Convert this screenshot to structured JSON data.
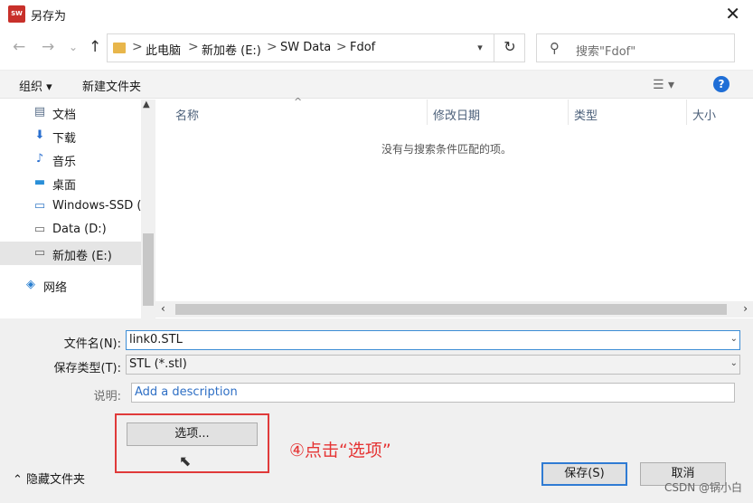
{
  "window": {
    "title": "另存为",
    "app_icon_text": "SW",
    "close": "✕"
  },
  "nav": {
    "back": "←",
    "forward": "→",
    "dropdown": "⌄",
    "up": "↑",
    "breadcrumbs": [
      "此电脑",
      "新加卷 (E:)",
      "SW Data",
      "Fdof"
    ],
    "separator": ">",
    "refresh": "↻",
    "search_placeholder": "搜索\"Fdof\""
  },
  "toolbar": {
    "organize": "组织 ▾",
    "new_folder": "新建文件夹",
    "view": "☰ ▾",
    "help": "?"
  },
  "sidebar": {
    "items": [
      {
        "label": "文档",
        "icon": "▤"
      },
      {
        "label": "下载",
        "icon": "⬇"
      },
      {
        "label": "音乐",
        "icon": "♪"
      },
      {
        "label": "桌面",
        "icon": "▬"
      },
      {
        "label": "Windows-SSD (",
        "icon": "▭"
      },
      {
        "label": "Data (D:)",
        "icon": "▭"
      },
      {
        "label": "新加卷 (E:)",
        "icon": "▭"
      },
      {
        "label": "网络",
        "icon": "◈"
      }
    ],
    "selected_index": 6
  },
  "filelist": {
    "columns": [
      "名称",
      "修改日期",
      "类型",
      "大小"
    ],
    "empty_message": "没有与搜索条件匹配的项。"
  },
  "form": {
    "filename_label": "文件名(N):",
    "filename_value": "link0.STL",
    "filetype_label": "保存类型(T):",
    "filetype_value": "STL (*.stl)",
    "description_label": "说明:",
    "description_value": "Add a description"
  },
  "buttons": {
    "options": "选项...",
    "save": "保存(S)",
    "cancel": "取消"
  },
  "hide_folders": "隐藏文件夹",
  "annotation": "④点击“选项”",
  "watermark": "CSDN @锅小白"
}
